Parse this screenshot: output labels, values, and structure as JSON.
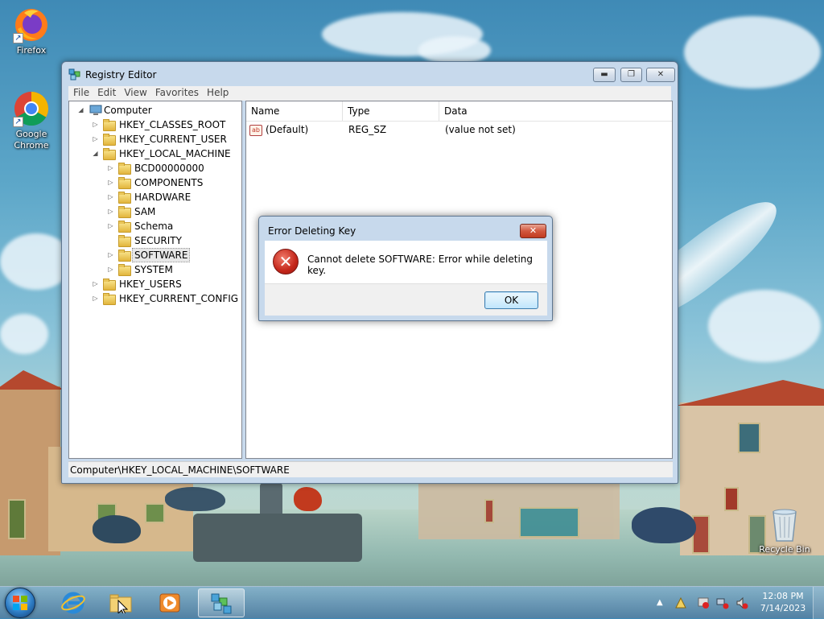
{
  "desktop": {
    "icons": [
      {
        "label": "Firefox"
      },
      {
        "label": "Google Chrome"
      },
      {
        "label": "Recycle Bin"
      }
    ]
  },
  "regedit": {
    "title": "Registry Editor",
    "menu": [
      "File",
      "Edit",
      "View",
      "Favorites",
      "Help"
    ],
    "tree": {
      "root": "Computer",
      "items": [
        {
          "label": "HKEY_CLASSES_ROOT"
        },
        {
          "label": "HKEY_CURRENT_USER"
        },
        {
          "label": "HKEY_LOCAL_MACHINE"
        },
        {
          "label": "BCD00000000"
        },
        {
          "label": "COMPONENTS"
        },
        {
          "label": "HARDWARE"
        },
        {
          "label": "SAM"
        },
        {
          "label": "Schema"
        },
        {
          "label": "SECURITY"
        },
        {
          "label": "SOFTWARE"
        },
        {
          "label": "SYSTEM"
        },
        {
          "label": "HKEY_USERS"
        },
        {
          "label": "HKEY_CURRENT_CONFIG"
        }
      ],
      "selected": "SOFTWARE"
    },
    "list": {
      "columns": [
        "Name",
        "Type",
        "Data"
      ],
      "rows": [
        {
          "name": "(Default)",
          "type": "REG_SZ",
          "data": "(value not set)"
        }
      ]
    },
    "status": "Computer\\HKEY_LOCAL_MACHINE\\SOFTWARE"
  },
  "dialog": {
    "title": "Error Deleting Key",
    "message": "Cannot delete SOFTWARE:  Error while deleting key.",
    "ok_label": "OK",
    "icon": "error-icon"
  },
  "taskbar": {
    "clock_time": "12:08 PM",
    "clock_date": "7/14/2023"
  },
  "colors": {
    "accent": "#2d7cc4",
    "error": "#c4261a",
    "window_frame": "#c7d9ec"
  }
}
